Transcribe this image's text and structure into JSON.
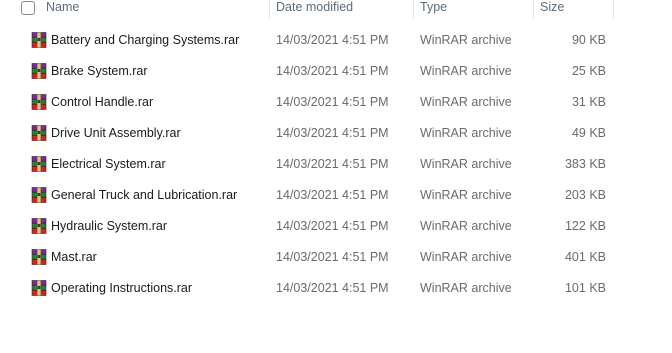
{
  "header": {
    "name": "Name",
    "date_modified": "Date modified",
    "type": "Type",
    "size": "Size"
  },
  "files": [
    {
      "name": "Battery and Charging Systems.rar",
      "date": "14/03/2021 4:51 PM",
      "type": "WinRAR archive",
      "size": "90 KB"
    },
    {
      "name": "Brake System.rar",
      "date": "14/03/2021 4:51 PM",
      "type": "WinRAR archive",
      "size": "25 KB"
    },
    {
      "name": "Control Handle.rar",
      "date": "14/03/2021 4:51 PM",
      "type": "WinRAR archive",
      "size": "31 KB"
    },
    {
      "name": "Drive Unit Assembly.rar",
      "date": "14/03/2021 4:51 PM",
      "type": "WinRAR archive",
      "size": "49 KB"
    },
    {
      "name": "Electrical System.rar",
      "date": "14/03/2021 4:51 PM",
      "type": "WinRAR archive",
      "size": "383 KB"
    },
    {
      "name": "General Truck and Lubrication.rar",
      "date": "14/03/2021 4:51 PM",
      "type": "WinRAR archive",
      "size": "203 KB"
    },
    {
      "name": "Hydraulic System.rar",
      "date": "14/03/2021 4:51 PM",
      "type": "WinRAR archive",
      "size": "122 KB"
    },
    {
      "name": "Mast.rar",
      "date": "14/03/2021 4:51 PM",
      "type": "WinRAR archive",
      "size": "401 KB"
    },
    {
      "name": "Operating Instructions.rar",
      "date": "14/03/2021 4:51 PM",
      "type": "WinRAR archive",
      "size": "101 KB"
    }
  ],
  "icons": {
    "file_icon": "winrar-archive-icon",
    "select_all": "checkbox-icon"
  }
}
